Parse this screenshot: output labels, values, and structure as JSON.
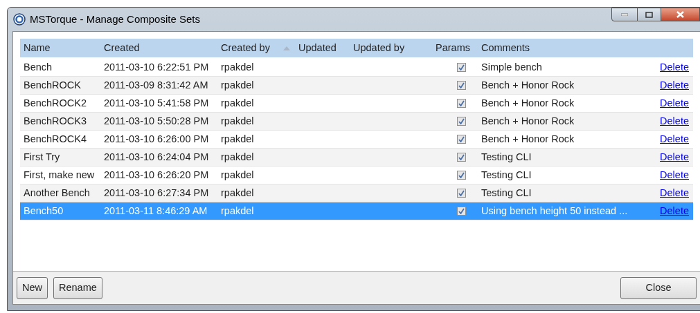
{
  "window": {
    "title": "MSTorque - Manage Composite Sets"
  },
  "table": {
    "columns": [
      {
        "label": "Name",
        "sorted": false
      },
      {
        "label": "Created",
        "sorted": false
      },
      {
        "label": "Created by",
        "sorted": false
      },
      {
        "label": "Updated",
        "sorted": true
      },
      {
        "label": "Updated by",
        "sorted": false
      },
      {
        "label": "Params",
        "sorted": false
      },
      {
        "label": "Comments",
        "sorted": false
      }
    ],
    "rows": [
      {
        "name": "Bench",
        "created": "2011-03-10 6:22:51 PM",
        "created_by": "rpakdel",
        "params": true,
        "comments": "Simple bench",
        "action": "Delete",
        "selected": false
      },
      {
        "name": "BenchROCK",
        "created": "2011-03-09 8:31:42 AM",
        "created_by": "rpakdel",
        "params": true,
        "comments": "Bench + Honor Rock",
        "action": "Delete",
        "selected": false
      },
      {
        "name": "BenchROCK2",
        "created": "2011-03-10 5:41:58 PM",
        "created_by": "rpakdel",
        "params": true,
        "comments": "Bench + Honor Rock",
        "action": "Delete",
        "selected": false
      },
      {
        "name": "BenchROCK3",
        "created": "2011-03-10 5:50:28 PM",
        "created_by": "rpakdel",
        "params": true,
        "comments": "Bench + Honor Rock",
        "action": "Delete",
        "selected": false
      },
      {
        "name": "BenchROCK4",
        "created": "2011-03-10 6:26:00 PM",
        "created_by": "rpakdel",
        "params": true,
        "comments": "Bench + Honor Rock",
        "action": "Delete",
        "selected": false
      },
      {
        "name": "First Try",
        "created": "2011-03-10 6:24:04 PM",
        "created_by": "rpakdel",
        "params": true,
        "comments": "Testing CLI",
        "action": "Delete",
        "selected": false
      },
      {
        "name": "First, make new",
        "created": "2011-03-10 6:26:20 PM",
        "created_by": "rpakdel",
        "params": true,
        "comments": "Testing CLI",
        "action": "Delete",
        "selected": false
      },
      {
        "name": "Another Bench",
        "created": "2011-03-10 6:27:34 PM",
        "created_by": "rpakdel",
        "params": true,
        "comments": "Testing CLI",
        "action": "Delete",
        "selected": false
      },
      {
        "name": "Bench50",
        "created": "2011-03-11 8:46:29 AM",
        "created_by": "rpakdel",
        "params": true,
        "comments": "Using bench height 50 instead ...",
        "action": "Delete",
        "selected": true
      }
    ]
  },
  "buttons": {
    "left": [
      "New",
      "Rename"
    ],
    "right": "Close"
  }
}
